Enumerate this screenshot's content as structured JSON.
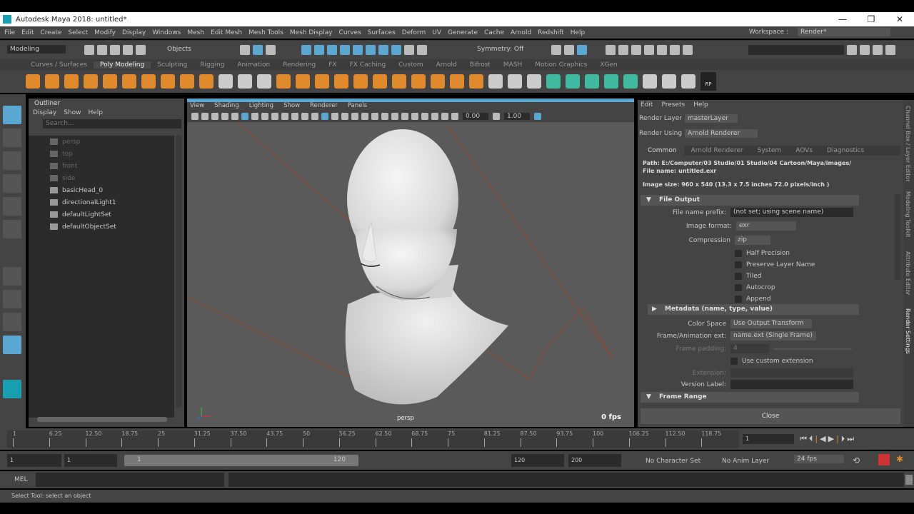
{
  "window": {
    "title": "Autodesk Maya 2018: untitled*",
    "controls": [
      "—",
      "❐",
      "✕"
    ]
  },
  "menu": [
    "File",
    "Edit",
    "Create",
    "Select",
    "Modify",
    "Display",
    "Windows",
    "Mesh",
    "Edit Mesh",
    "Mesh Tools",
    "Mesh Display",
    "Curves",
    "Surfaces",
    "Deform",
    "UV",
    "Generate",
    "Cache",
    "Arnold",
    "Redshift",
    "Help"
  ],
  "workspace": {
    "label": "Workspace :",
    "value": "Render*"
  },
  "status": {
    "mode": "Modeling",
    "objects": "Objects",
    "symmetry": "Symmetry: Off"
  },
  "shelf_tabs": [
    "Curves / Surfaces",
    "Poly Modeling",
    "Sculpting",
    "Rigging",
    "Animation",
    "Rendering",
    "FX",
    "FX Caching",
    "Custom",
    "Arnold",
    "Bifrost",
    "MASH",
    "Motion Graphics",
    "XGen"
  ],
  "shelf_active": "Poly Modeling",
  "shelf_rp": "RP",
  "outliner": {
    "title": "Outliner",
    "menu": [
      "Display",
      "Show",
      "Help"
    ],
    "search_placeholder": "Search...",
    "items": [
      {
        "name": "persp",
        "dim": true
      },
      {
        "name": "top",
        "dim": true
      },
      {
        "name": "front",
        "dim": true
      },
      {
        "name": "side",
        "dim": true
      },
      {
        "name": "basicHead_0",
        "dim": false
      },
      {
        "name": "directionalLight1",
        "dim": false
      },
      {
        "name": "defaultLightSet",
        "dim": false
      },
      {
        "name": "defaultObjectSet",
        "dim": false
      }
    ]
  },
  "viewport": {
    "menu": [
      "View",
      "Shading",
      "Lighting",
      "Show",
      "Renderer",
      "Panels"
    ],
    "exposure": "0.00",
    "gamma": "1.00",
    "camera": "persp",
    "fps": "0 fps"
  },
  "render_settings": {
    "menu": [
      "Edit",
      "Presets",
      "Help"
    ],
    "render_layer_label": "Render Layer",
    "render_layer": "masterLayer",
    "render_using_label": "Render Using",
    "render_using": "Arnold Renderer",
    "tabs": [
      "Common",
      "Arnold Renderer",
      "System",
      "AOVs",
      "Diagnostics"
    ],
    "path": "Path: E:/Computer/03 Studio/01 Studio/04 Cartoon/Maya/images/",
    "file_name": "File name:  untitled.exr",
    "image_size": "Image size: 960 x 540 (13.3 x 7.5 inches 72.0 pixels/inch )",
    "file_output": "File Output",
    "prefix_label": "File name prefix:",
    "prefix": "(not set; using scene name)",
    "format_label": "Image format:",
    "format": "exr",
    "compression_label": "Compression",
    "compression": "zip",
    "checks": [
      "Half Precision",
      "Preserve Layer Name",
      "Tiled",
      "Autocrop",
      "Append"
    ],
    "metadata": "Metadata (name, type, value)",
    "colorspace_label": "Color Space",
    "colorspace": "Use Output Transform",
    "frameext_label": "Frame/Animation ext:",
    "frameext": "name.ext (Single Frame)",
    "padding_label": "Frame padding:",
    "padding": "4",
    "custom_ext": "Use custom extension",
    "extension_label": "Extension:",
    "version_label": "Version Label:",
    "frame_range": "Frame Range",
    "close": "Close"
  },
  "side_tabs": [
    "Channel Box / Layer Editor",
    "Modeling Toolkit",
    "Attribute Editor",
    "Render Settings"
  ],
  "timeline": {
    "ticks": [
      "1",
      "6.25",
      "12.50",
      "18.75",
      "25",
      "31.25",
      "37.50",
      "43.75",
      "50",
      "56.25",
      "62.50",
      "68.75",
      "75",
      "81.25",
      "87.50",
      "93.75",
      "100",
      "106.25",
      "112.50",
      "118.75"
    ],
    "current": "1"
  },
  "range": {
    "start": "1",
    "anim_start": "1",
    "slider_start": "1",
    "slider_end": "120",
    "end": "120",
    "anim_end": "200",
    "character": "No Character Set",
    "anim_layer": "No Anim Layer",
    "fps": "24 fps"
  },
  "mel": "MEL",
  "help": "Select Tool: select an object"
}
